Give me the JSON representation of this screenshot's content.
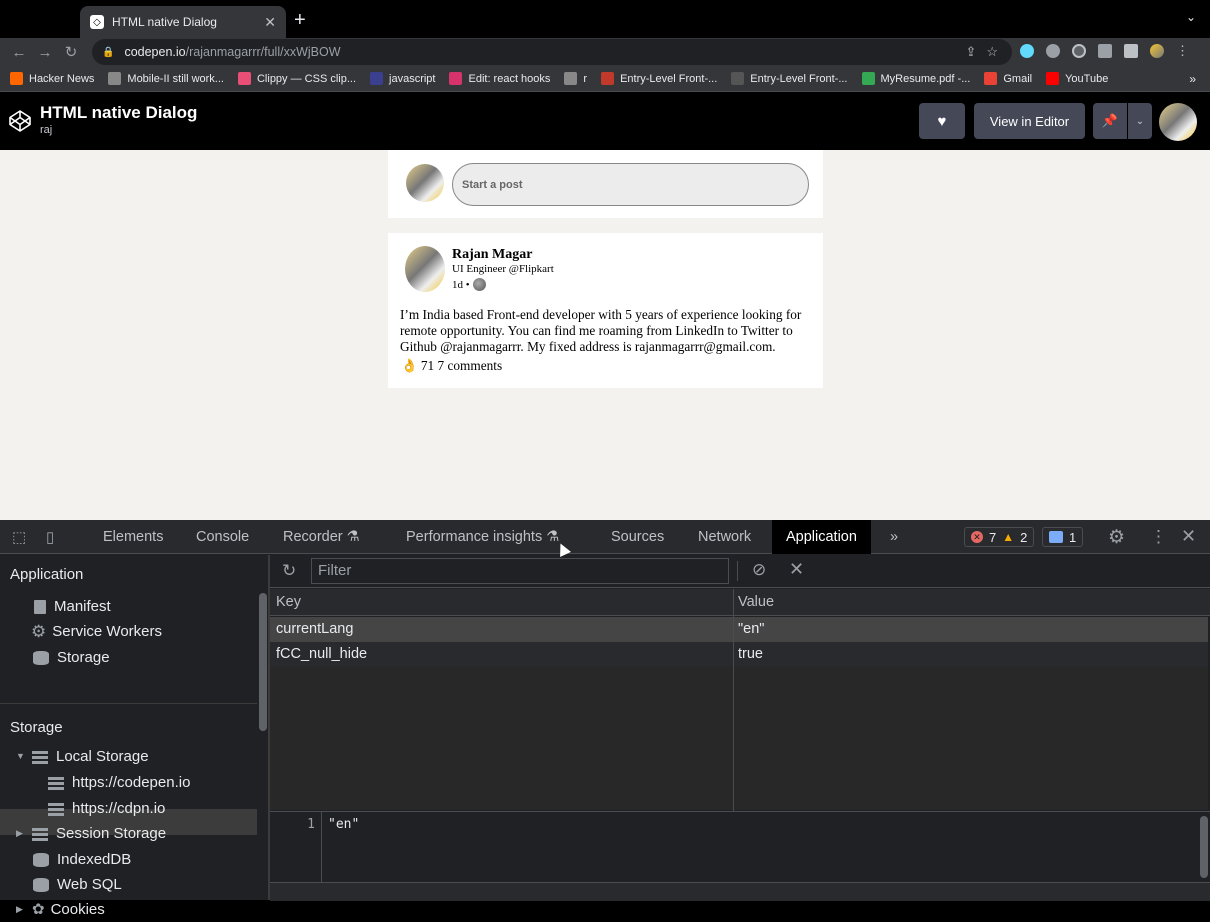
{
  "browser": {
    "tab_title": "HTML native Dialog",
    "url_host": "codepen.io",
    "url_path": "/rajanmagarrr/full/xxWjBOW",
    "bookmarks": [
      {
        "label": "Hacker News",
        "color": "#ff6600"
      },
      {
        "label": "Mobile-II still work...",
        "color": "#888888"
      },
      {
        "label": "Clippy — CSS clip...",
        "color": "#e94e77"
      },
      {
        "label": "javascript",
        "color": "#3b3f8f"
      },
      {
        "label": "Edit: react hooks",
        "color": "#d6336c"
      },
      {
        "label": "r",
        "color": "#888888"
      },
      {
        "label": "Entry-Level Front-...",
        "color": "#c0392b"
      },
      {
        "label": "Entry-Level Front-...",
        "color": "#555555"
      },
      {
        "label": "MyResume.pdf -...",
        "color": "#34a853"
      },
      {
        "label": "Gmail",
        "color": "#ea4335"
      },
      {
        "label": "YouTube",
        "color": "#ff0000"
      }
    ],
    "bookmarks_more": "»"
  },
  "codepen": {
    "title": "HTML native Dialog",
    "user": "raj",
    "view_in_editor": "View in Editor"
  },
  "post_composer": {
    "placeholder": "Start a post"
  },
  "post": {
    "name": "Rajan Magar",
    "subtitle": "UI Engineer @Flipkart",
    "time": "1d •",
    "body": "I’m India based Front-end developer with 5 years of experience looking for remote opportunity. You can find me roaming from LinkedIn to Twitter to Github @rajanmagarrr. My fixed address is rajanmagarrr@gmail.com.",
    "reactions": "👌 71 7 comments"
  },
  "devtools": {
    "tabs": [
      "Elements",
      "Console",
      "Recorder",
      "Performance insights",
      "Sources",
      "Network",
      "Application"
    ],
    "more": "»",
    "errors": "7",
    "warnings": "2",
    "messages": "1",
    "sidebar": {
      "application_heading": "Application",
      "application_items": [
        "Manifest",
        "Service Workers",
        "Storage"
      ],
      "storage_heading": "Storage",
      "local_storage": "Local Storage",
      "local_storage_children": [
        "https://codepen.io",
        "https://cdpn.io"
      ],
      "session_storage": "Session Storage",
      "indexeddb": "IndexedDB",
      "websql": "Web SQL",
      "cookies": "Cookies"
    },
    "filter_placeholder": "Filter",
    "columns": {
      "key": "Key",
      "value": "Value"
    },
    "rows": [
      {
        "key": "currentLang",
        "value": "\"en\""
      },
      {
        "key": "fCC_null_hide",
        "value": "true"
      }
    ],
    "preview": {
      "line": "1",
      "text": "\"en\""
    }
  }
}
